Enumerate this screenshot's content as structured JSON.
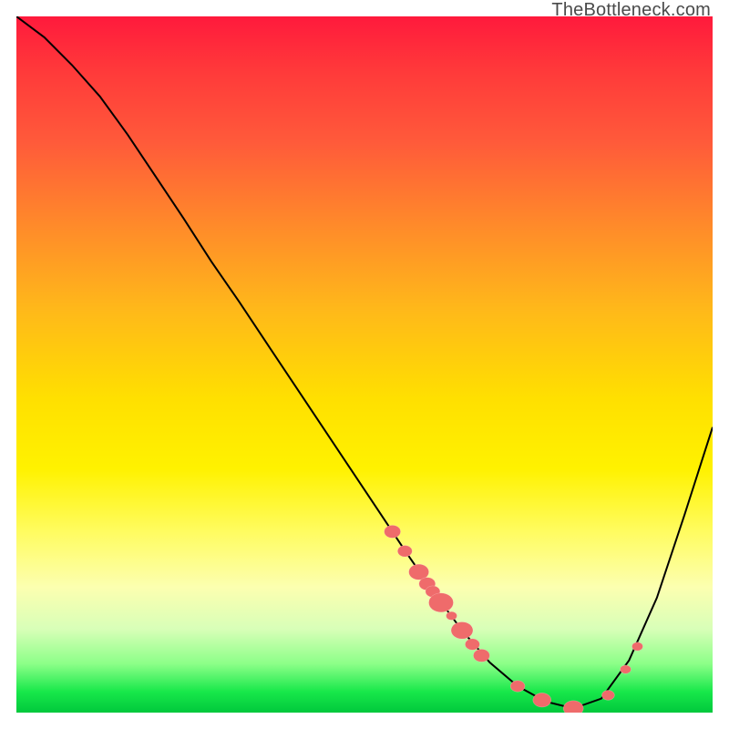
{
  "watermark": "TheBottleneck.com",
  "chart_data": {
    "type": "line",
    "title": "",
    "xlabel": "",
    "ylabel": "",
    "xlim": [
      0,
      1
    ],
    "ylim": [
      0,
      1
    ],
    "curve": [
      {
        "x": 0.0,
        "y": 1.0
      },
      {
        "x": 0.04,
        "y": 0.97
      },
      {
        "x": 0.08,
        "y": 0.93
      },
      {
        "x": 0.12,
        "y": 0.885
      },
      {
        "x": 0.16,
        "y": 0.83
      },
      {
        "x": 0.2,
        "y": 0.77
      },
      {
        "x": 0.24,
        "y": 0.71
      },
      {
        "x": 0.28,
        "y": 0.648
      },
      {
        "x": 0.32,
        "y": 0.59
      },
      {
        "x": 0.36,
        "y": 0.53
      },
      {
        "x": 0.4,
        "y": 0.47
      },
      {
        "x": 0.44,
        "y": 0.41
      },
      {
        "x": 0.48,
        "y": 0.35
      },
      {
        "x": 0.52,
        "y": 0.29
      },
      {
        "x": 0.56,
        "y": 0.23
      },
      {
        "x": 0.6,
        "y": 0.172
      },
      {
        "x": 0.64,
        "y": 0.118
      },
      {
        "x": 0.68,
        "y": 0.072
      },
      {
        "x": 0.72,
        "y": 0.038
      },
      {
        "x": 0.76,
        "y": 0.016
      },
      {
        "x": 0.8,
        "y": 0.006
      },
      {
        "x": 0.84,
        "y": 0.02
      },
      {
        "x": 0.88,
        "y": 0.075
      },
      {
        "x": 0.92,
        "y": 0.165
      },
      {
        "x": 0.96,
        "y": 0.285
      },
      {
        "x": 1.0,
        "y": 0.41
      }
    ],
    "markers": [
      {
        "x": 0.54,
        "y": 0.26,
        "r": 9
      },
      {
        "x": 0.558,
        "y": 0.232,
        "r": 8
      },
      {
        "x": 0.578,
        "y": 0.202,
        "r": 11
      },
      {
        "x": 0.59,
        "y": 0.185,
        "r": 9
      },
      {
        "x": 0.598,
        "y": 0.174,
        "r": 8
      },
      {
        "x": 0.61,
        "y": 0.158,
        "r": 13.5
      },
      {
        "x": 0.625,
        "y": 0.139,
        "r": 6
      },
      {
        "x": 0.64,
        "y": 0.118,
        "r": 12
      },
      {
        "x": 0.655,
        "y": 0.098,
        "r": 8
      },
      {
        "x": 0.668,
        "y": 0.082,
        "r": 9
      },
      {
        "x": 0.72,
        "y": 0.038,
        "r": 8
      },
      {
        "x": 0.755,
        "y": 0.018,
        "r": 10
      },
      {
        "x": 0.8,
        "y": 0.006,
        "r": 11
      },
      {
        "x": 0.85,
        "y": 0.025,
        "r": 7
      },
      {
        "x": 0.875,
        "y": 0.062,
        "r": 6
      },
      {
        "x": 0.892,
        "y": 0.095,
        "r": 6
      }
    ]
  }
}
